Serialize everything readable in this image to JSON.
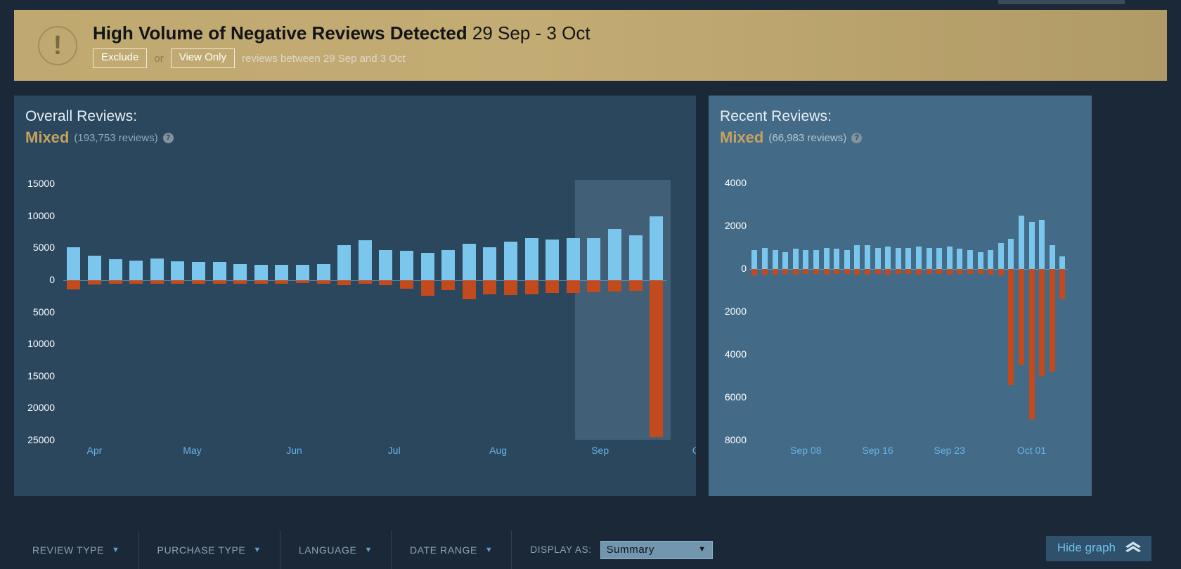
{
  "banner": {
    "icon": "warning-exclamation-icon",
    "title_bold": "High Volume of Negative Reviews Detected",
    "title_range": "29 Sep - 3 Oct",
    "exclude_label": "Exclude",
    "or_label": "or",
    "view_only_label": "View Only",
    "tail_text": "reviews between 29 Sep and 3 Oct",
    "bg_color": "#c0a970"
  },
  "overall": {
    "heading": "Overall Reviews:",
    "verdict": "Mixed",
    "count": "(193,753 reviews)",
    "help": "?"
  },
  "recent": {
    "heading": "Recent Reviews:",
    "verdict": "Mixed",
    "count": "(66,983 reviews)",
    "help": "?"
  },
  "filters": [
    {
      "label": "REVIEW TYPE",
      "caret": "▼"
    },
    {
      "label": "PURCHASE TYPE",
      "caret": "▼"
    },
    {
      "label": "LANGUAGE",
      "caret": "▼"
    },
    {
      "label": "DATE RANGE",
      "caret": "▼"
    }
  ],
  "display_as": {
    "label": "DISPLAY AS:",
    "value": "Summary",
    "caret": "▼"
  },
  "hide_graph": {
    "label": "Hide graph",
    "chevron": "«"
  },
  "colors": {
    "positive_bar": "#7bc6ed",
    "negative_bar": "#c24a1c",
    "verdict": "#c5a25e",
    "panel_overall_bg": "#2a475e",
    "panel_recent_bg": "#436b87",
    "page_bg": "#1b2838",
    "axis_text": "#ffffff",
    "xaxis_text": "#66b5e8"
  },
  "chart_data": [
    {
      "id": "overall-reviews-chart",
      "type": "bar",
      "title": "Overall Reviews",
      "orientation": "diverging-vertical",
      "xlabel": "",
      "ylabel": "",
      "grid": false,
      "legend": null,
      "y_ticks": [
        15000,
        10000,
        5000,
        0,
        5000,
        10000,
        15000,
        20000,
        25000
      ],
      "y_tick_labels": [
        "15000",
        "10000",
        "5000",
        "0",
        "5000",
        "10000",
        "15000",
        "20000",
        "25000"
      ],
      "ylim": [
        -25000,
        17000
      ],
      "x_tick_labels": [
        "Apr",
        "May",
        "Jun",
        "Jul",
        "Aug",
        "Sep",
        "Oct"
      ],
      "x_tick_positions": [
        1,
        5.7,
        10.6,
        15.4,
        20.4,
        25.3,
        30.1
      ],
      "highlight_band": {
        "start_index": 24.6,
        "end_index": 29.2,
        "label": "29 Sep - 3 Oct"
      },
      "series": [
        {
          "name": "Positive",
          "color": "#7bc6ed",
          "values": [
            5200,
            3800,
            3300,
            3100,
            3400,
            3000,
            2900,
            2800,
            2500,
            2400,
            2400,
            2400,
            2500,
            5500,
            6200,
            4700,
            4600,
            4300,
            4700,
            5700,
            5200,
            6000,
            6600,
            6400,
            6600,
            6600,
            8000,
            7000,
            10000
          ]
        },
        {
          "name": "Negative",
          "color": "#c24a1c",
          "values": [
            -1400,
            -700,
            -600,
            -600,
            -500,
            -500,
            -500,
            -500,
            -500,
            -500,
            -500,
            -400,
            -500,
            -800,
            -600,
            -800,
            -1300,
            -2400,
            -1500,
            -3000,
            -2200,
            -2300,
            -2200,
            -2000,
            -2000,
            -1900,
            -1700,
            -1600,
            -24500
          ]
        }
      ]
    },
    {
      "id": "recent-reviews-chart",
      "type": "bar",
      "title": "Recent Reviews",
      "orientation": "diverging-vertical",
      "xlabel": "",
      "ylabel": "",
      "grid": false,
      "legend": null,
      "y_ticks": [
        4000,
        2000,
        0,
        2000,
        4000,
        6000,
        8000
      ],
      "y_tick_labels": [
        "4000",
        "2000",
        "0",
        "2000",
        "4000",
        "6000",
        "8000"
      ],
      "ylim": [
        -8000,
        4500
      ],
      "x_tick_labels": [
        "Sep 08",
        "Sep 16",
        "Sep 23",
        "Oct 01"
      ],
      "x_tick_positions": [
        5,
        12,
        19,
        27
      ],
      "series": [
        {
          "name": "Positive",
          "color": "#7bc6ed",
          "values": [
            900,
            1000,
            900,
            800,
            950,
            900,
            900,
            1000,
            950,
            900,
            1100,
            1100,
            1000,
            1050,
            1000,
            1000,
            1050,
            1000,
            1000,
            1050,
            950,
            900,
            800,
            900,
            1200,
            1400,
            2500,
            2200,
            2300,
            1100,
            600
          ]
        },
        {
          "name": "Negative",
          "color": "#c24a1c",
          "values": [
            -280,
            -260,
            -250,
            -240,
            -250,
            -230,
            -240,
            -250,
            -230,
            -240,
            -260,
            -250,
            -240,
            -250,
            -230,
            -240,
            -250,
            -240,
            -230,
            -250,
            -240,
            -230,
            -220,
            -250,
            -300,
            -5400,
            -4500,
            -7000,
            -5000,
            -4800,
            -1400
          ]
        }
      ]
    }
  ]
}
